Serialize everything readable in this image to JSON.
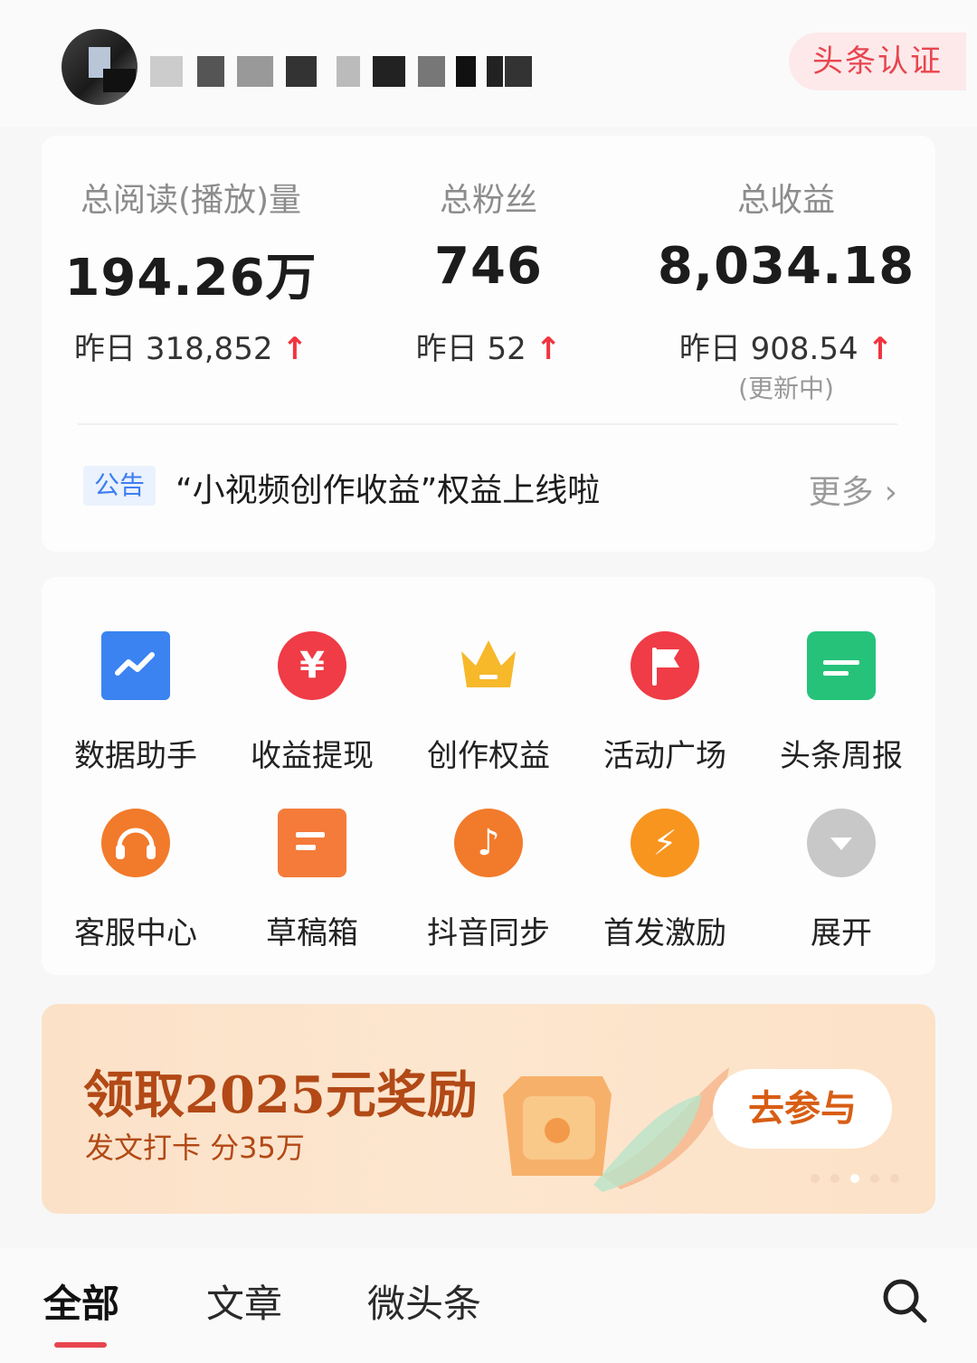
{
  "header": {
    "username": "",
    "cert_label": "头条认证"
  },
  "stats": [
    {
      "label": "总阅读(播放)量",
      "value": "194.26万",
      "delta": "昨日 318,852",
      "arrow": "↑",
      "note": ""
    },
    {
      "label": "总粉丝",
      "value": "746",
      "delta": "昨日 52",
      "arrow": "↑",
      "note": ""
    },
    {
      "label": "总收益",
      "value": "8,034.18",
      "delta": "昨日 908.54",
      "arrow": "↑",
      "note": "(更新中)"
    }
  ],
  "notice": {
    "badge": "公告",
    "text": "“小视频创作收益”权益上线啦",
    "more": "更多",
    "chevron": "›"
  },
  "tools": [
    {
      "label": "数据助手",
      "icon": "chart-icon"
    },
    {
      "label": "收益提现",
      "icon": "yuan-icon",
      "glyph": "¥"
    },
    {
      "label": "创作权益",
      "icon": "crown-icon"
    },
    {
      "label": "活动广场",
      "icon": "flag-icon"
    },
    {
      "label": "头条周报",
      "icon": "calendar-icon"
    },
    {
      "label": "客服中心",
      "icon": "headset-icon"
    },
    {
      "label": "草稿箱",
      "icon": "draft-icon"
    },
    {
      "label": "抖音同步",
      "icon": "douyin-icon",
      "glyph": "♪"
    },
    {
      "label": "首发激励",
      "icon": "lightning-icon",
      "glyph": "⚡"
    },
    {
      "label": "展开",
      "icon": "expand-icon"
    }
  ],
  "banner": {
    "title": "领取2025元奖励",
    "subtitle": "发文打卡 分35万",
    "button": "去参与",
    "slides": 5,
    "active_slide": 3
  },
  "tabs": {
    "items": [
      "全部",
      "文章",
      "微头条"
    ],
    "active": 0
  },
  "colors": {
    "accent_red": "#e8454f",
    "stat_arrow": "#f0343f",
    "notice_blue": "#3f7ef2",
    "banner_text": "#b24916"
  }
}
